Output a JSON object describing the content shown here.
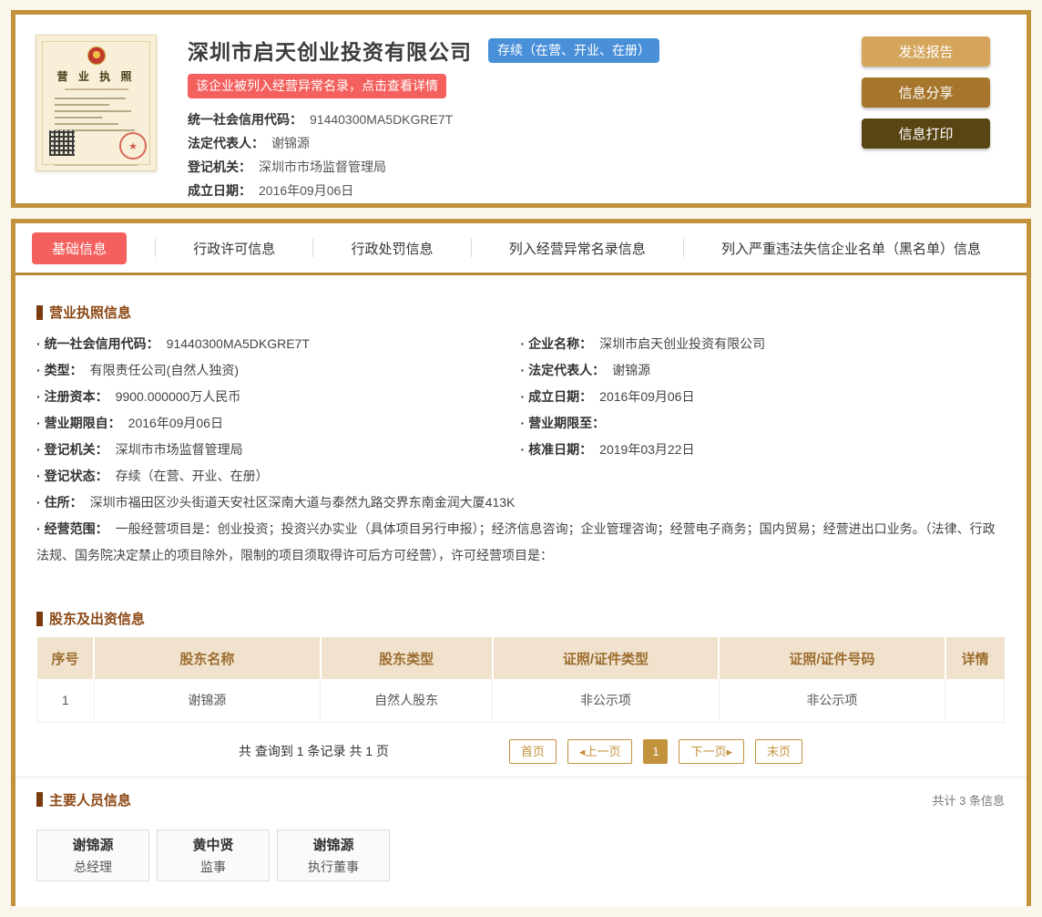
{
  "header": {
    "company_name": "深圳市启天创业投资有限公司",
    "status_badge": "存续（在营、开业、在册）",
    "warning_badge": "该企业被列入经营异常名录，点击查看详情",
    "license_image_title": "营 业 执 照",
    "fields": [
      {
        "label": "统一社会信用代码：",
        "value": "91440300MA5DKGRE7T"
      },
      {
        "label": "法定代表人：",
        "value": "谢锦源"
      },
      {
        "label": "登记机关：",
        "value": "深圳市市场监督管理局"
      },
      {
        "label": "成立日期：",
        "value": "2016年09月06日"
      }
    ],
    "buttons": [
      {
        "label": "发送报告"
      },
      {
        "label": "信息分享"
      },
      {
        "label": "信息打印"
      }
    ]
  },
  "tabs": [
    {
      "label": "基础信息",
      "active": true
    },
    {
      "label": "行政许可信息",
      "active": false
    },
    {
      "label": "行政处罚信息",
      "active": false
    },
    {
      "label": "列入经营异常名录信息",
      "active": false
    },
    {
      "label": "列入严重违法失信企业名单（黑名单）信息",
      "active": false
    }
  ],
  "license_section": {
    "title": "营业执照信息",
    "left_fields": [
      {
        "label": "统一社会信用代码：",
        "value": "91440300MA5DKGRE7T"
      },
      {
        "label": "类型：",
        "value": "有限责任公司(自然人独资)"
      },
      {
        "label": "注册资本：",
        "value": "9900.000000万人民币"
      },
      {
        "label": "营业期限自：",
        "value": "2016年09月06日"
      },
      {
        "label": "登记机关：",
        "value": "深圳市市场监督管理局"
      },
      {
        "label": "登记状态：",
        "value": "存续（在营、开业、在册）"
      }
    ],
    "right_fields": [
      {
        "label": "企业名称：",
        "value": "深圳市启天创业投资有限公司"
      },
      {
        "label": "法定代表人：",
        "value": "谢锦源"
      },
      {
        "label": "成立日期：",
        "value": "2016年09月06日"
      },
      {
        "label": "营业期限至：",
        "value": ""
      },
      {
        "label": "核准日期：",
        "value": "2019年03月22日"
      }
    ],
    "full_fields": [
      {
        "label": "住所：",
        "value": "深圳市福田区沙头街道天安社区深南大道与泰然九路交界东南金润大厦413K"
      },
      {
        "label": "经营范围：",
        "value": "一般经营项目是：创业投资；投资兴办实业（具体项目另行申报）；经济信息咨询；企业管理咨询；经营电子商务；国内贸易；经营进出口业务。（法律、行政法规、国务院决定禁止的项目除外，限制的项目须取得许可后方可经营），许可经营项目是："
      }
    ]
  },
  "shareholders": {
    "title": "股东及出资信息",
    "columns": [
      "序号",
      "股东名称",
      "股东类型",
      "证照/证件类型",
      "证照/证件号码",
      "详情"
    ],
    "rows": [
      [
        "1",
        "谢锦源",
        "自然人股东",
        "非公示项",
        "非公示项",
        ""
      ]
    ],
    "summary": "共 查询到 1 条记录 共 1 页",
    "pagination": {
      "first": "首页",
      "prev": "◂上一页",
      "current": "1",
      "next": "下一页▸",
      "last": "末页"
    }
  },
  "key_people": {
    "title": "主要人员信息",
    "count_text": "共计 3 条信息",
    "people": [
      {
        "name": "谢锦源",
        "role": "总经理"
      },
      {
        "name": "黄中贤",
        "role": "监事"
      },
      {
        "name": "谢锦源",
        "role": "执行董事"
      }
    ]
  },
  "colors": {
    "gold_border": "#c3923c",
    "page_background": "#faf6eb",
    "active_tab_red": "#f4605d",
    "warning_red": "#f4605d",
    "status_blue": "#4a90d9",
    "button_send": "#d5a55b",
    "button_share": "#a6762d",
    "button_print": "#594414",
    "section_title": "#8c4714",
    "table_header_bg": "#f0e2cd",
    "table_header_text": "#9c6d2f"
  }
}
